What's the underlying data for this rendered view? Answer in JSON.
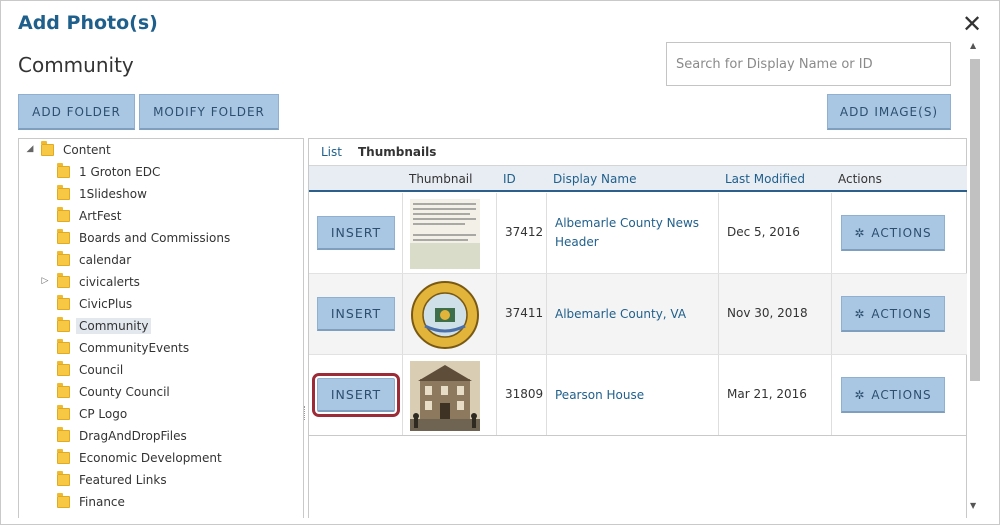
{
  "dialog": {
    "title": "Add Photo(s)",
    "close_glyph": "✕",
    "current_folder": "Community"
  },
  "search": {
    "placeholder": "Search for Display Name or ID",
    "value": ""
  },
  "buttons": {
    "add_folder": "ADD FOLDER",
    "modify_folder": "MODIFY FOLDER",
    "add_images": "ADD IMAGE(S)"
  },
  "tree": {
    "root": "Content",
    "items": [
      {
        "label": "1 Groton EDC"
      },
      {
        "label": "1Slideshow"
      },
      {
        "label": "ArtFest"
      },
      {
        "label": "Boards and Commissions"
      },
      {
        "label": "calendar"
      },
      {
        "label": "civicalerts",
        "expandable": true
      },
      {
        "label": "CivicPlus"
      },
      {
        "label": "Community",
        "selected": true
      },
      {
        "label": "CommunityEvents"
      },
      {
        "label": "Council"
      },
      {
        "label": "County Council"
      },
      {
        "label": "CP Logo"
      },
      {
        "label": "DragAndDropFiles"
      },
      {
        "label": "Economic Development"
      },
      {
        "label": "Featured Links"
      },
      {
        "label": "Finance"
      }
    ]
  },
  "view_tabs": {
    "list": "List",
    "thumbnails": "Thumbnails",
    "active": "Thumbnails"
  },
  "table": {
    "headers": {
      "thumbnail": "Thumbnail",
      "id": "ID",
      "display_name": "Display Name",
      "last_modified": "Last Modified",
      "actions": "Actions"
    },
    "rows": [
      {
        "insert": "INSERT",
        "thumbnail": "document-thumbnail",
        "id": "37412",
        "display_name_line1": "Albemarle County News",
        "display_name_line2": "Header",
        "last_modified": "Dec 5, 2016",
        "actions": "ACTIONS"
      },
      {
        "insert": "INSERT",
        "thumbnail": "county-seal-thumbnail",
        "id": "37411",
        "display_name_line1": "Albemarle County, VA",
        "display_name_line2": "",
        "last_modified": "Nov 30, 2018",
        "actions": "ACTIONS"
      },
      {
        "insert": "INSERT",
        "thumbnail": "house-photo-thumbnail",
        "id": "31809",
        "display_name_line1": "Pearson House",
        "display_name_line2": "",
        "last_modified": "Mar 21, 2016",
        "actions": "ACTIONS",
        "highlighted": true
      }
    ]
  },
  "colors": {
    "title": "#1f5f8b",
    "button_bg": "#a9c7e3",
    "link": "#1f5f8b",
    "header_rule": "#2c5f8a",
    "highlight": "#9c2a37"
  }
}
